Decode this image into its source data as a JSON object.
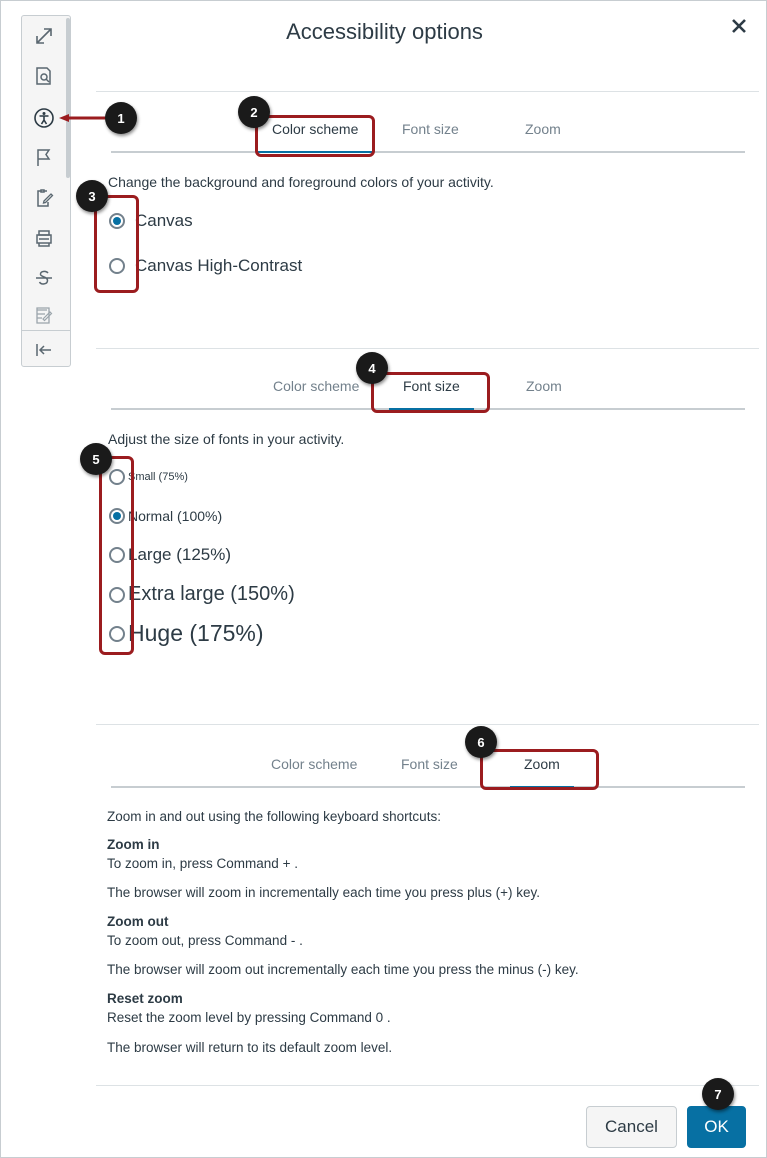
{
  "dialog": {
    "title": "Accessibility options",
    "close_icon": "close-icon"
  },
  "toolbar": {
    "icons": [
      "expand-icon",
      "preview-icon",
      "accessibility-icon",
      "flag-icon",
      "clipboard-edit-icon",
      "print-icon",
      "strikethrough-icon",
      "notes-icon",
      "collapse-icon"
    ]
  },
  "sections": {
    "color_scheme": {
      "tabs": [
        "Color scheme",
        "Font size",
        "Zoom"
      ],
      "active_tab": "Color scheme",
      "description": "Change the background and foreground colors of your activity.",
      "options": [
        "Canvas",
        "Canvas High-Contrast"
      ],
      "selected": "Canvas"
    },
    "font_size": {
      "tabs": [
        "Color scheme",
        "Font size",
        "Zoom"
      ],
      "active_tab": "Font size",
      "description": "Adjust the size of fonts in your activity.",
      "options": [
        "Small (75%)",
        "Normal (100%)",
        "Large (125%)",
        "Extra large (150%)",
        "Huge (175%)"
      ],
      "selected": "Normal (100%)"
    },
    "zoom": {
      "tabs": [
        "Color scheme",
        "Font size",
        "Zoom"
      ],
      "active_tab": "Zoom",
      "intro": "Zoom in and out using the following keyboard shortcuts:",
      "zoom_in_heading": "Zoom in",
      "zoom_in_line": "To zoom in, press Command + .",
      "zoom_in_note": "The browser will zoom in incrementally each time you press plus (+) key.",
      "zoom_out_heading": "Zoom out",
      "zoom_out_line": "To zoom out, press Command - .",
      "zoom_out_note": "The browser will zoom out incrementally each time you press the minus (-) key.",
      "reset_heading": "Reset zoom",
      "reset_line": "Reset the zoom level by pressing Command 0 .",
      "reset_note": "The browser will return to its default zoom level."
    }
  },
  "footer": {
    "cancel_label": "Cancel",
    "ok_label": "OK"
  },
  "callouts": [
    "1",
    "2",
    "3",
    "4",
    "5",
    "6",
    "7"
  ],
  "colors": {
    "accent": "#0770a3",
    "callout_border": "#9b1c1f",
    "badge": "#1a1a1a",
    "text": "#2d3b45",
    "muted": "#73818c"
  }
}
